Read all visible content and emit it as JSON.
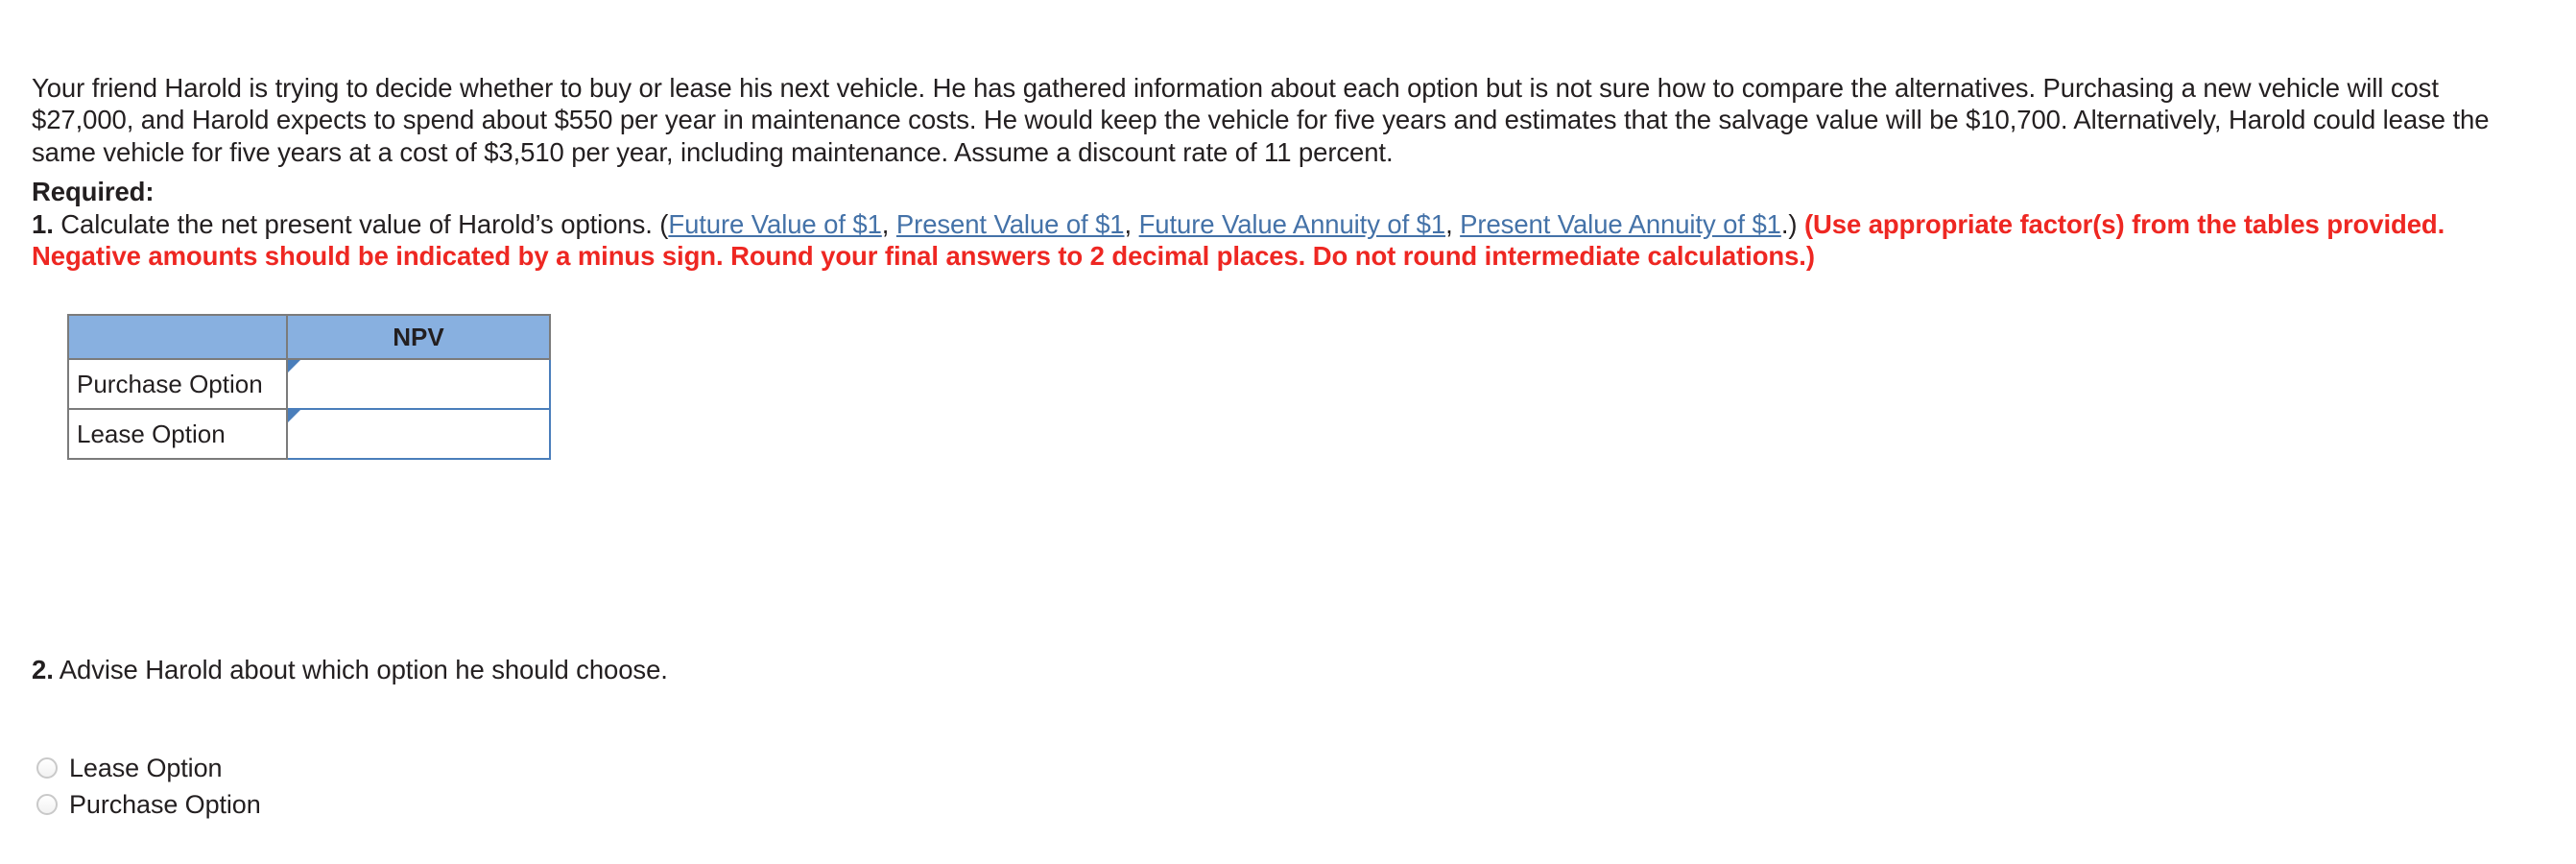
{
  "problem": {
    "text": "Your friend Harold is trying to decide whether to buy or lease his next vehicle. He has gathered information about each option but is not sure how to compare the alternatives. Purchasing a new vehicle will cost $27,000, and Harold expects to spend about $550 per year in maintenance costs. He would keep the vehicle for five years and estimates that the salvage value will be $10,700. Alternatively, Harold could lease the same vehicle for five years at a cost of $3,510 per year, including maintenance. Assume a discount rate of 11 percent."
  },
  "required": {
    "heading": "Required:",
    "item1": {
      "number": "1.",
      "text_before_links": " Calculate the net present value of Harold’s options. (",
      "links": [
        "Future Value of $1",
        "Present Value of $1",
        "Future Value Annuity of $1",
        "Present Value Annuity of $1"
      ],
      "link_separator": ", ",
      "text_after_links": ".) ",
      "red_note": "(Use appropriate factor(s) from the tables provided. Negative amounts should be indicated by a minus sign. Round your final answers to 2 decimal places. Do not round intermediate calculations.)"
    }
  },
  "npv_table": {
    "header_blank": "",
    "header_value": "NPV",
    "rows": [
      {
        "label": "Purchase Option",
        "value": "",
        "placeholder": ""
      },
      {
        "label": "Lease Option",
        "value": "",
        "placeholder": ""
      }
    ]
  },
  "question2": {
    "number": "2.",
    "text": " Advise Harold about which option he should choose.",
    "options": [
      {
        "label": "Lease Option",
        "selected": false
      },
      {
        "label": "Purchase Option",
        "selected": false
      }
    ]
  },
  "colors": {
    "link": "#4472a8",
    "red_note": "#ee2722",
    "table_header_fill": "#88b0e0",
    "table_border": "#7b7b7b",
    "input_border": "#4a7ebb",
    "text": "#231f20"
  }
}
